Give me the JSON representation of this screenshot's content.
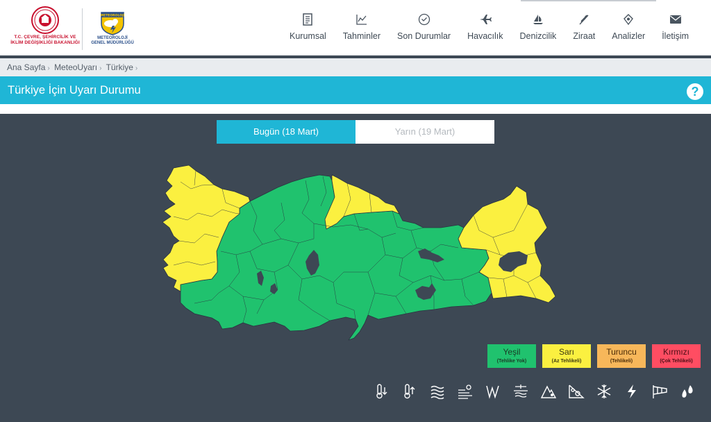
{
  "header": {
    "ministry_logo_text_1": "T.C. ÇEVRE, ŞEHİRCİLİK VE",
    "ministry_logo_text_2": "İKLİM DEĞİŞİKLİĞİ BAKANLIĞI",
    "mgm_logo_badge": "METEOROLOJİ",
    "mgm_logo_text_1": "METEOROLOJİ",
    "mgm_logo_text_2": "GENEL MÜDÜRLÜĞÜ"
  },
  "nav": [
    {
      "label": "Kurumsal",
      "icon": "document-icon"
    },
    {
      "label": "Tahminler",
      "icon": "chart-icon"
    },
    {
      "label": "Son Durumlar",
      "icon": "check-circle-icon"
    },
    {
      "label": "Havacılık",
      "icon": "airplane-icon"
    },
    {
      "label": "Denizcilik",
      "icon": "sailboat-icon"
    },
    {
      "label": "Ziraat",
      "icon": "wheat-icon"
    },
    {
      "label": "Analizler",
      "icon": "analysis-icon"
    },
    {
      "label": "İletişim",
      "icon": "envelope-icon"
    }
  ],
  "breadcrumb": [
    "Ana Sayfa",
    "MeteoUyarı",
    "Türkiye"
  ],
  "page_title": "Türkiye İçin Uyarı Durumu",
  "help_label": "?",
  "tabs": [
    {
      "label": "Bugün (18 Mart)",
      "active": true
    },
    {
      "label": "Yarın (19 Mart)",
      "active": false
    }
  ],
  "map": {
    "colors": {
      "green": "#20c26e",
      "yellow": "#fbf040",
      "lake": "#3d4854",
      "border": "#2a3340"
    }
  },
  "legend": [
    {
      "label": "Yeşil",
      "sub": "(Tehlike Yok)",
      "color": "#20c26e"
    },
    {
      "label": "Sarı",
      "sub": "(Az Tehlikeli)",
      "color": "#fbf040"
    },
    {
      "label": "Turuncu",
      "sub": "(Tehlikeli)",
      "color": "#f7b75a"
    },
    {
      "label": "Kırmızı",
      "sub": "(Çok Tehlikeli)",
      "color": "#ff4d62"
    }
  ],
  "weather_icons": [
    "cold-temperature-icon",
    "hot-temperature-icon",
    "fog-icon",
    "dust-storm-icon",
    "strong-wind-icon",
    "snow-melt-icon",
    "avalanche-icon",
    "landslide-icon",
    "snow-icon",
    "lightning-icon",
    "windsock-icon",
    "rain-icon"
  ]
}
